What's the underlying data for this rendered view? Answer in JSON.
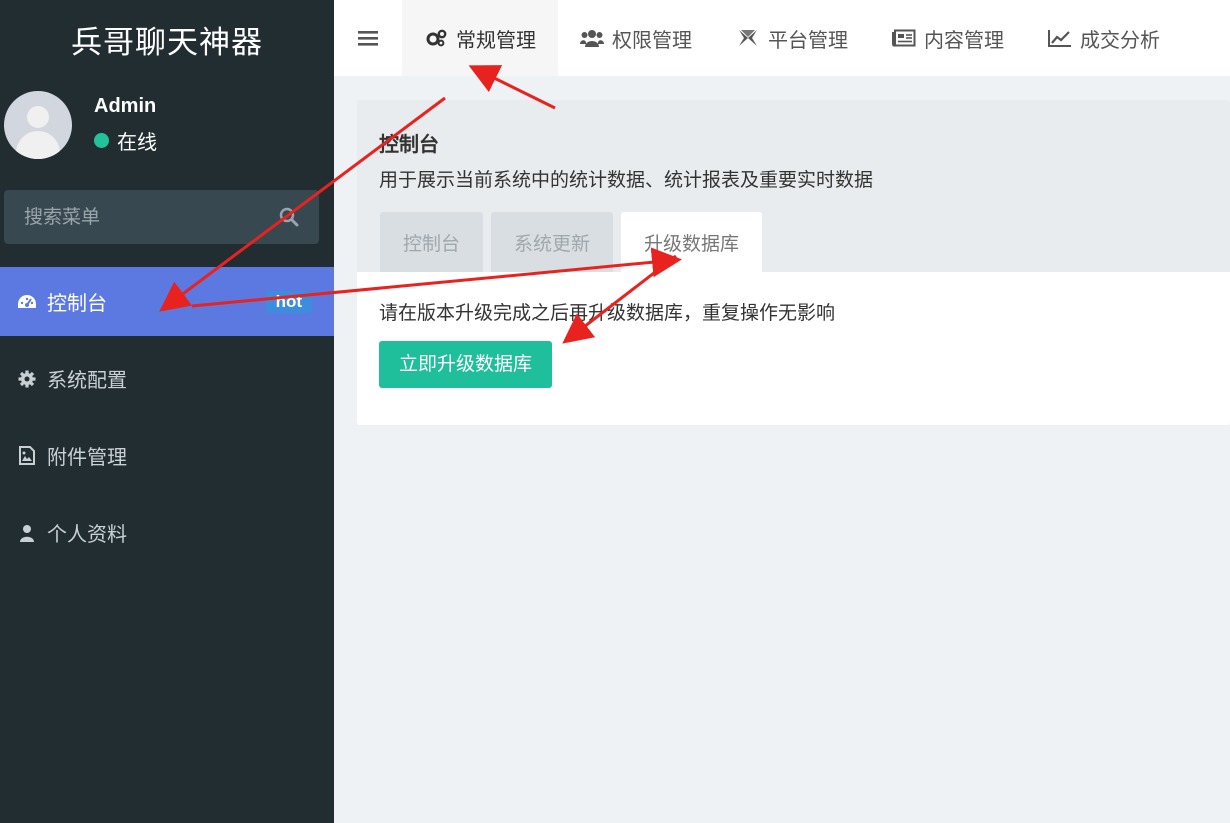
{
  "sidebar": {
    "brand": "兵哥聊天神器",
    "user": {
      "name": "Admin",
      "status": "在线"
    },
    "search_placeholder": "搜索菜单",
    "items": [
      {
        "label": "控制台",
        "icon": "dashboard-icon",
        "badge": "hot",
        "active": true
      },
      {
        "label": "系统配置",
        "icon": "gear-icon"
      },
      {
        "label": "附件管理",
        "icon": "image-file-icon"
      },
      {
        "label": "个人资料",
        "icon": "user-icon"
      }
    ]
  },
  "topnav": {
    "tabs": [
      {
        "label": "常规管理",
        "icon": "cogs-icon",
        "active": true
      },
      {
        "label": "权限管理",
        "icon": "users-icon"
      },
      {
        "label": "平台管理",
        "icon": "leaf-icon"
      },
      {
        "label": "内容管理",
        "icon": "newspaper-icon"
      },
      {
        "label": "成交分析",
        "icon": "line-chart-icon"
      }
    ]
  },
  "panel": {
    "title": "控制台",
    "description": "用于展示当前系统中的统计数据、统计报表及重要实时数据",
    "subtabs": [
      {
        "label": "控制台"
      },
      {
        "label": "系统更新"
      },
      {
        "label": "升级数据库",
        "active": true
      }
    ],
    "text": "请在版本升级完成之后再升级数据库，重复操作无影响",
    "button": "立即升级数据库"
  },
  "colors": {
    "sidebar_bg": "#222d32",
    "active_menu": "#5b79e1",
    "online_dot": "#22c39b",
    "primary_button": "#20bf9b",
    "annotation_arrow": "#e8231f"
  }
}
